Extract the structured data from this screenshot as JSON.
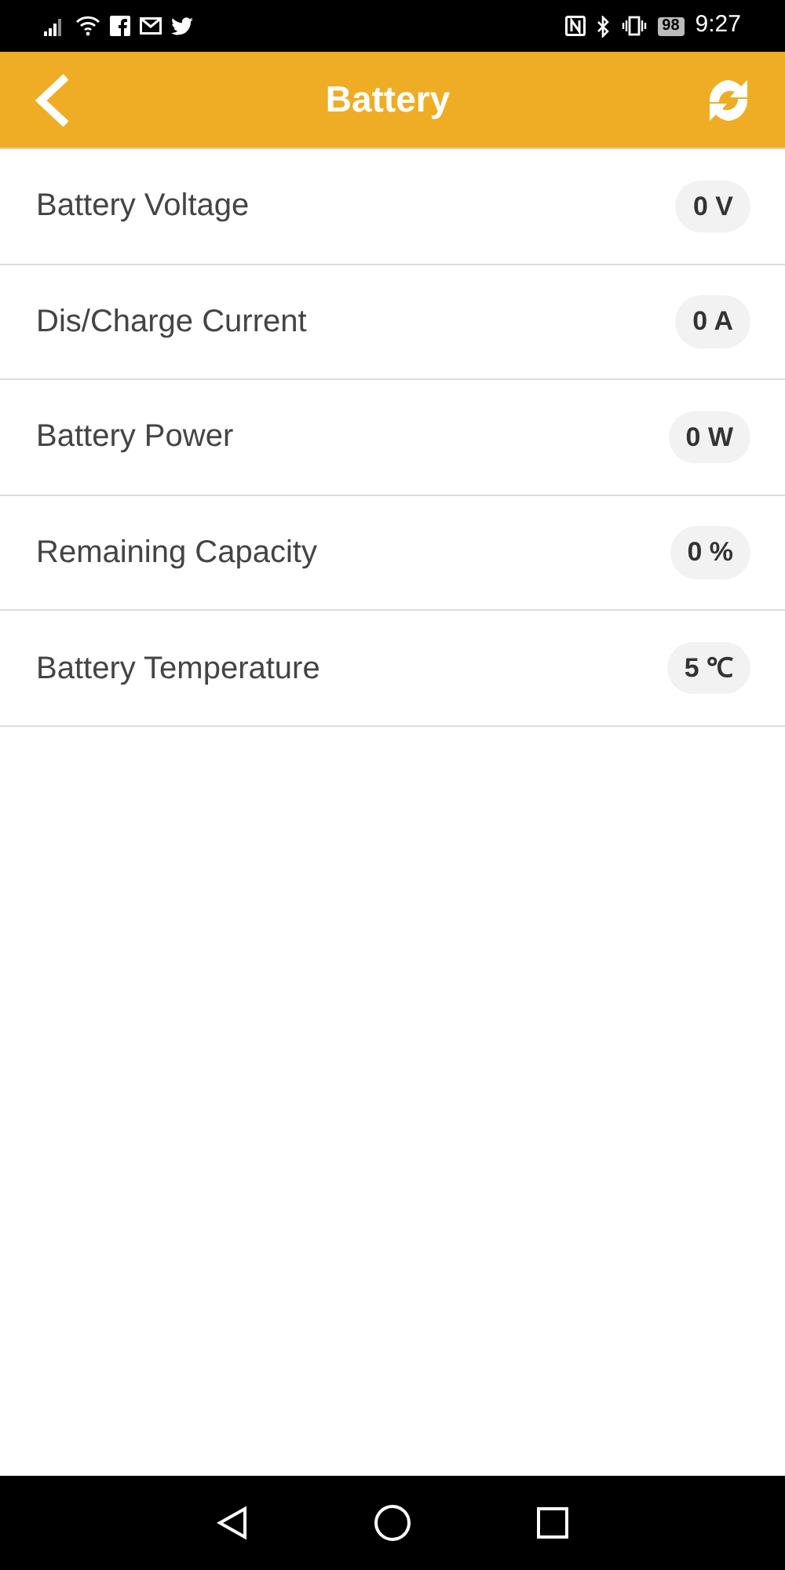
{
  "status_bar": {
    "battery": "98",
    "time": "9:27"
  },
  "header": {
    "title": "Battery"
  },
  "rows": [
    {
      "label": "Battery Voltage",
      "value": "0 V"
    },
    {
      "label": "Dis/Charge Current",
      "value": "0 A"
    },
    {
      "label": "Battery Power",
      "value": "0 W"
    },
    {
      "label": "Remaining Capacity",
      "value": "0 %"
    },
    {
      "label": "Battery Temperature",
      "value": "5 ℃"
    }
  ]
}
